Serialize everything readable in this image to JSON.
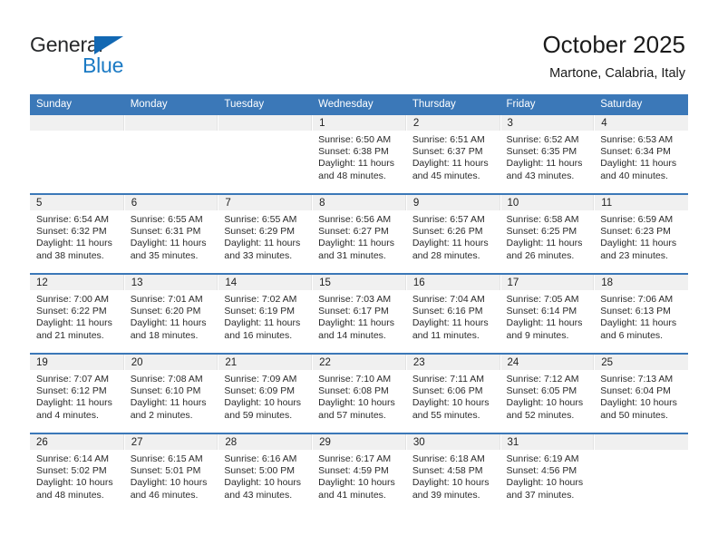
{
  "brand": {
    "name_line1": "General",
    "name_line2": "Blue",
    "accent_color": "#1b7ac4",
    "triangle_color": "#1268b3"
  },
  "header": {
    "title": "October 2025",
    "subtitle": "Martone, Calabria, Italy",
    "header_bg": "#3b78b8",
    "daynum_band_bg": "#f0f0f0"
  },
  "weekday_headers": [
    "Sunday",
    "Monday",
    "Tuesday",
    "Wednesday",
    "Thursday",
    "Friday",
    "Saturday"
  ],
  "weeks": [
    [
      {
        "day": "",
        "sunrise": "",
        "sunset": "",
        "daylight_line1": "",
        "daylight_line2": ""
      },
      {
        "day": "",
        "sunrise": "",
        "sunset": "",
        "daylight_line1": "",
        "daylight_line2": ""
      },
      {
        "day": "",
        "sunrise": "",
        "sunset": "",
        "daylight_line1": "",
        "daylight_line2": ""
      },
      {
        "day": "1",
        "sunrise": "Sunrise: 6:50 AM",
        "sunset": "Sunset: 6:38 PM",
        "daylight_line1": "Daylight: 11 hours",
        "daylight_line2": "and 48 minutes."
      },
      {
        "day": "2",
        "sunrise": "Sunrise: 6:51 AM",
        "sunset": "Sunset: 6:37 PM",
        "daylight_line1": "Daylight: 11 hours",
        "daylight_line2": "and 45 minutes."
      },
      {
        "day": "3",
        "sunrise": "Sunrise: 6:52 AM",
        "sunset": "Sunset: 6:35 PM",
        "daylight_line1": "Daylight: 11 hours",
        "daylight_line2": "and 43 minutes."
      },
      {
        "day": "4",
        "sunrise": "Sunrise: 6:53 AM",
        "sunset": "Sunset: 6:34 PM",
        "daylight_line1": "Daylight: 11 hours",
        "daylight_line2": "and 40 minutes."
      }
    ],
    [
      {
        "day": "5",
        "sunrise": "Sunrise: 6:54 AM",
        "sunset": "Sunset: 6:32 PM",
        "daylight_line1": "Daylight: 11 hours",
        "daylight_line2": "and 38 minutes."
      },
      {
        "day": "6",
        "sunrise": "Sunrise: 6:55 AM",
        "sunset": "Sunset: 6:31 PM",
        "daylight_line1": "Daylight: 11 hours",
        "daylight_line2": "and 35 minutes."
      },
      {
        "day": "7",
        "sunrise": "Sunrise: 6:55 AM",
        "sunset": "Sunset: 6:29 PM",
        "daylight_line1": "Daylight: 11 hours",
        "daylight_line2": "and 33 minutes."
      },
      {
        "day": "8",
        "sunrise": "Sunrise: 6:56 AM",
        "sunset": "Sunset: 6:27 PM",
        "daylight_line1": "Daylight: 11 hours",
        "daylight_line2": "and 31 minutes."
      },
      {
        "day": "9",
        "sunrise": "Sunrise: 6:57 AM",
        "sunset": "Sunset: 6:26 PM",
        "daylight_line1": "Daylight: 11 hours",
        "daylight_line2": "and 28 minutes."
      },
      {
        "day": "10",
        "sunrise": "Sunrise: 6:58 AM",
        "sunset": "Sunset: 6:25 PM",
        "daylight_line1": "Daylight: 11 hours",
        "daylight_line2": "and 26 minutes."
      },
      {
        "day": "11",
        "sunrise": "Sunrise: 6:59 AM",
        "sunset": "Sunset: 6:23 PM",
        "daylight_line1": "Daylight: 11 hours",
        "daylight_line2": "and 23 minutes."
      }
    ],
    [
      {
        "day": "12",
        "sunrise": "Sunrise: 7:00 AM",
        "sunset": "Sunset: 6:22 PM",
        "daylight_line1": "Daylight: 11 hours",
        "daylight_line2": "and 21 minutes."
      },
      {
        "day": "13",
        "sunrise": "Sunrise: 7:01 AM",
        "sunset": "Sunset: 6:20 PM",
        "daylight_line1": "Daylight: 11 hours",
        "daylight_line2": "and 18 minutes."
      },
      {
        "day": "14",
        "sunrise": "Sunrise: 7:02 AM",
        "sunset": "Sunset: 6:19 PM",
        "daylight_line1": "Daylight: 11 hours",
        "daylight_line2": "and 16 minutes."
      },
      {
        "day": "15",
        "sunrise": "Sunrise: 7:03 AM",
        "sunset": "Sunset: 6:17 PM",
        "daylight_line1": "Daylight: 11 hours",
        "daylight_line2": "and 14 minutes."
      },
      {
        "day": "16",
        "sunrise": "Sunrise: 7:04 AM",
        "sunset": "Sunset: 6:16 PM",
        "daylight_line1": "Daylight: 11 hours",
        "daylight_line2": "and 11 minutes."
      },
      {
        "day": "17",
        "sunrise": "Sunrise: 7:05 AM",
        "sunset": "Sunset: 6:14 PM",
        "daylight_line1": "Daylight: 11 hours",
        "daylight_line2": "and 9 minutes."
      },
      {
        "day": "18",
        "sunrise": "Sunrise: 7:06 AM",
        "sunset": "Sunset: 6:13 PM",
        "daylight_line1": "Daylight: 11 hours",
        "daylight_line2": "and 6 minutes."
      }
    ],
    [
      {
        "day": "19",
        "sunrise": "Sunrise: 7:07 AM",
        "sunset": "Sunset: 6:12 PM",
        "daylight_line1": "Daylight: 11 hours",
        "daylight_line2": "and 4 minutes."
      },
      {
        "day": "20",
        "sunrise": "Sunrise: 7:08 AM",
        "sunset": "Sunset: 6:10 PM",
        "daylight_line1": "Daylight: 11 hours",
        "daylight_line2": "and 2 minutes."
      },
      {
        "day": "21",
        "sunrise": "Sunrise: 7:09 AM",
        "sunset": "Sunset: 6:09 PM",
        "daylight_line1": "Daylight: 10 hours",
        "daylight_line2": "and 59 minutes."
      },
      {
        "day": "22",
        "sunrise": "Sunrise: 7:10 AM",
        "sunset": "Sunset: 6:08 PM",
        "daylight_line1": "Daylight: 10 hours",
        "daylight_line2": "and 57 minutes."
      },
      {
        "day": "23",
        "sunrise": "Sunrise: 7:11 AM",
        "sunset": "Sunset: 6:06 PM",
        "daylight_line1": "Daylight: 10 hours",
        "daylight_line2": "and 55 minutes."
      },
      {
        "day": "24",
        "sunrise": "Sunrise: 7:12 AM",
        "sunset": "Sunset: 6:05 PM",
        "daylight_line1": "Daylight: 10 hours",
        "daylight_line2": "and 52 minutes."
      },
      {
        "day": "25",
        "sunrise": "Sunrise: 7:13 AM",
        "sunset": "Sunset: 6:04 PM",
        "daylight_line1": "Daylight: 10 hours",
        "daylight_line2": "and 50 minutes."
      }
    ],
    [
      {
        "day": "26",
        "sunrise": "Sunrise: 6:14 AM",
        "sunset": "Sunset: 5:02 PM",
        "daylight_line1": "Daylight: 10 hours",
        "daylight_line2": "and 48 minutes."
      },
      {
        "day": "27",
        "sunrise": "Sunrise: 6:15 AM",
        "sunset": "Sunset: 5:01 PM",
        "daylight_line1": "Daylight: 10 hours",
        "daylight_line2": "and 46 minutes."
      },
      {
        "day": "28",
        "sunrise": "Sunrise: 6:16 AM",
        "sunset": "Sunset: 5:00 PM",
        "daylight_line1": "Daylight: 10 hours",
        "daylight_line2": "and 43 minutes."
      },
      {
        "day": "29",
        "sunrise": "Sunrise: 6:17 AM",
        "sunset": "Sunset: 4:59 PM",
        "daylight_line1": "Daylight: 10 hours",
        "daylight_line2": "and 41 minutes."
      },
      {
        "day": "30",
        "sunrise": "Sunrise: 6:18 AM",
        "sunset": "Sunset: 4:58 PM",
        "daylight_line1": "Daylight: 10 hours",
        "daylight_line2": "and 39 minutes."
      },
      {
        "day": "31",
        "sunrise": "Sunrise: 6:19 AM",
        "sunset": "Sunset: 4:56 PM",
        "daylight_line1": "Daylight: 10 hours",
        "daylight_line2": "and 37 minutes."
      },
      {
        "day": "",
        "sunrise": "",
        "sunset": "",
        "daylight_line1": "",
        "daylight_line2": ""
      }
    ]
  ]
}
